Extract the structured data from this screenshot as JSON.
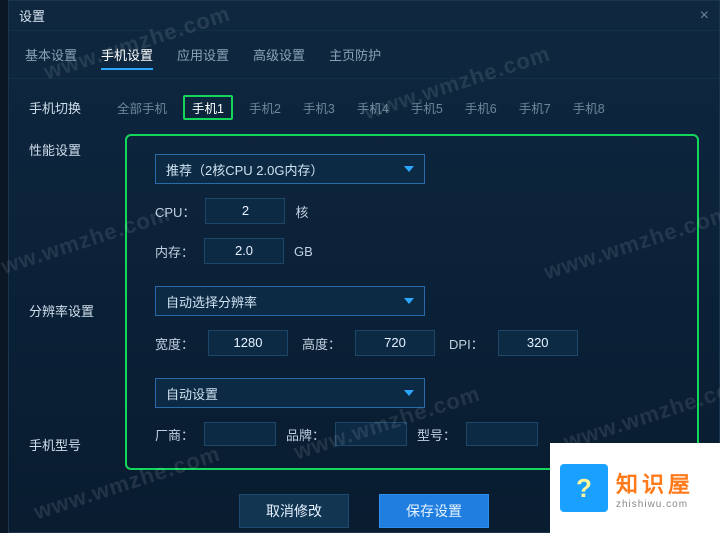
{
  "title": "设置",
  "tabs": [
    "基本设置",
    "手机设置",
    "应用设置",
    "高级设置",
    "主页防护"
  ],
  "active_tab": 1,
  "phone_switch_label": "手机切换",
  "phone_tabs": [
    "全部手机",
    "手机1",
    "手机2",
    "手机3",
    "手机4",
    "手机5",
    "手机6",
    "手机7",
    "手机8"
  ],
  "active_phone_tab": 1,
  "perf": {
    "label": "性能设置",
    "preset": "推荐（2核CPU 2.0G内存）",
    "cpu_label": "CPU：",
    "cpu_value": "2",
    "cpu_unit": "核",
    "mem_label": "内存：",
    "mem_value": "2.0",
    "mem_unit": "GB"
  },
  "res": {
    "label": "分辨率设置",
    "preset": "自动选择分辨率",
    "width_label": "宽度：",
    "width_value": "1280",
    "height_label": "高度：",
    "height_value": "720",
    "dpi_label": "DPI：",
    "dpi_value": "320"
  },
  "model": {
    "label": "手机型号",
    "preset": "自动设置",
    "vendor_label": "厂商：",
    "brand_label": "品牌：",
    "model_label": "型号："
  },
  "buttons": {
    "cancel": "取消修改",
    "save": "保存设置"
  },
  "watermark": "www.wmzhe.com",
  "logo": {
    "cn": "知识屋",
    "url": "zhishiwu.com"
  }
}
